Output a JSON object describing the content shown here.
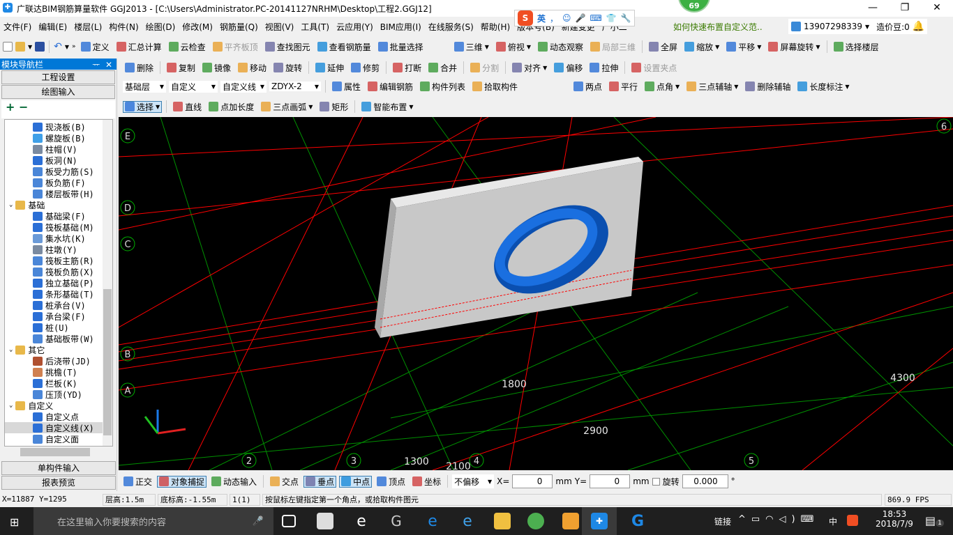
{
  "title": {
    "text": "广联达BIM钢筋算量软件 GGJ2013 - [C:\\Users\\Administrator.PC-20141127NRHM\\Desktop\\工程2.GGJ12]",
    "badge": "69",
    "minimize": "—",
    "restore": "❐",
    "close": "✕"
  },
  "ime": {
    "label": "英",
    "items": [
      "，",
      "☺",
      "🎤",
      "⌨",
      "👕",
      "🔧"
    ]
  },
  "menu": [
    "文件(F)",
    "编辑(E)",
    "楼层(L)",
    "构件(N)",
    "绘图(D)",
    "修改(M)",
    "钢筋量(Q)",
    "视图(V)",
    "工具(T)",
    "云应用(Y)",
    "BIM应用(I)",
    "在线服务(S)",
    "帮助(H)",
    "版本号(B)",
    "新建变更",
    "广小二"
  ],
  "menu_right": {
    "tip": "如何快速布置自定义范..",
    "user": "13907298339",
    "beans": "造价豆:0"
  },
  "toolbar1": {
    "items": [
      "定义",
      "汇总计算",
      "云检查",
      "平齐板顶",
      "查找图元",
      "查看钢筋量",
      "批量选择"
    ],
    "view_items": [
      "三维",
      "俯视",
      "动态观察",
      "局部三维",
      "全屏",
      "缩放",
      "平移",
      "屏幕旋转",
      "选择楼层"
    ]
  },
  "toolbar2": [
    "删除",
    "复制",
    "镜像",
    "移动",
    "旋转",
    "延伸",
    "修剪",
    "打断",
    "合并",
    "分割",
    "对齐",
    "偏移",
    "拉伸",
    "设置夹点"
  ],
  "toolbar3": {
    "floor": "基础层",
    "type": "自定义",
    "subtype": "自定义线",
    "name": "ZDYX-2",
    "items": [
      "属性",
      "编辑钢筋",
      "构件列表",
      "拾取构件"
    ],
    "axis_items": [
      "两点",
      "平行",
      "点角",
      "三点辅轴",
      "删除辅轴",
      "长度标注"
    ]
  },
  "toolbar4": [
    "选择",
    "直线",
    "点加长度",
    "三点画弧",
    "矩形",
    "智能布置"
  ],
  "panel": {
    "title": "模块导航栏",
    "pin": "ᅲ",
    "close": "✕",
    "btn_project": "工程设置",
    "btn_draw": "绘图输入",
    "btn_single": "单构件输入",
    "btn_report": "报表预览",
    "expand": "+",
    "collapse": "−"
  },
  "tree": [
    {
      "level": 2,
      "label": "现浇板(B)",
      "color": "#2b6fd6"
    },
    {
      "level": 2,
      "label": "螺旋板(B)",
      "color": "#3fa0e8"
    },
    {
      "level": 2,
      "label": "柱帽(V)",
      "color": "#7a8aa0"
    },
    {
      "level": 2,
      "label": "板洞(N)",
      "color": "#2b6fd6"
    },
    {
      "level": 2,
      "label": "板受力筋(S)",
      "color": "#4a86d8"
    },
    {
      "level": 2,
      "label": "板负筋(F)",
      "color": "#4a86d8"
    },
    {
      "level": 2,
      "label": "楼层板带(H)",
      "color": "#4a86d8"
    },
    {
      "level": 1,
      "label": "基础",
      "color": "#e8b84a"
    },
    {
      "level": 2,
      "label": "基础梁(F)",
      "color": "#2b6fd6"
    },
    {
      "level": 2,
      "label": "筏板基础(M)",
      "color": "#2b6fd6"
    },
    {
      "level": 2,
      "label": "集水坑(K)",
      "color": "#6a9ad8"
    },
    {
      "level": 2,
      "label": "柱墩(Y)",
      "color": "#7a8aa0"
    },
    {
      "level": 2,
      "label": "筏板主筋(R)",
      "color": "#4a86d8"
    },
    {
      "level": 2,
      "label": "筏板负筋(X)",
      "color": "#4a86d8"
    },
    {
      "level": 2,
      "label": "独立基础(P)",
      "color": "#2b6fd6"
    },
    {
      "level": 2,
      "label": "条形基础(T)",
      "color": "#2b6fd6"
    },
    {
      "level": 2,
      "label": "桩承台(V)",
      "color": "#2b6fd6"
    },
    {
      "level": 2,
      "label": "承台梁(F)",
      "color": "#2b6fd6"
    },
    {
      "level": 2,
      "label": "桩(U)",
      "color": "#2b6fd6"
    },
    {
      "level": 2,
      "label": "基础板带(W)",
      "color": "#4a86d8"
    },
    {
      "level": 1,
      "label": "其它",
      "color": "#e8b84a"
    },
    {
      "level": 2,
      "label": "后浇带(JD)",
      "color": "#b05030"
    },
    {
      "level": 2,
      "label": "挑檐(T)",
      "color": "#d08050"
    },
    {
      "level": 2,
      "label": "栏板(K)",
      "color": "#2b6fd6"
    },
    {
      "level": 2,
      "label": "压顶(YD)",
      "color": "#4a86d8"
    },
    {
      "level": 1,
      "label": "自定义",
      "color": "#e8b84a"
    },
    {
      "level": 2,
      "label": "自定义点",
      "color": "#2b6fd6"
    },
    {
      "level": 2,
      "label": "自定义线(X)",
      "color": "#2b6fd6",
      "selected": true
    },
    {
      "level": 2,
      "label": "自定义面",
      "color": "#4a86d8"
    }
  ],
  "viewport": {
    "axis_labels_row": [
      "E",
      "D",
      "C",
      "B",
      "A"
    ],
    "axis_labels_col": [
      "2",
      "3",
      "4",
      "5",
      "6"
    ],
    "dimensions": [
      "1800",
      "4300",
      "2900",
      "1300",
      "2100"
    ],
    "colors": {
      "background": "#000000",
      "axis_red": "#ff0000",
      "grid_green": "#00b000",
      "slab": "#c8c8c8",
      "ring": "#1a6fe0"
    }
  },
  "bottom_toolbar": {
    "items": [
      "正交",
      "对象捕捉",
      "动态输入",
      "交点",
      "垂点",
      "中点",
      "顶点",
      "坐标"
    ],
    "offset": "不偏移",
    "x_label": "X=",
    "x_value": "0",
    "y_label": "Y=",
    "y_value": "0",
    "unit": "mm",
    "rotate_label": "旋转",
    "rotate_value": "0.000",
    "degree": "°"
  },
  "status": {
    "coords": "X=11887 Y=1295",
    "floor_height": "层高:1.5m",
    "bottom_height": "底标高:-1.55m",
    "count": "1(1)",
    "hint": "按鼠标左键指定第一个角点，或拾取构件图元",
    "fps": "869.9 FPS"
  },
  "taskbar": {
    "search_placeholder": "在这里输入你要搜索的内容",
    "tray_text": "链接",
    "ime": "中",
    "time": "18:53",
    "date": "2018/7/9",
    "notifications": "1"
  }
}
